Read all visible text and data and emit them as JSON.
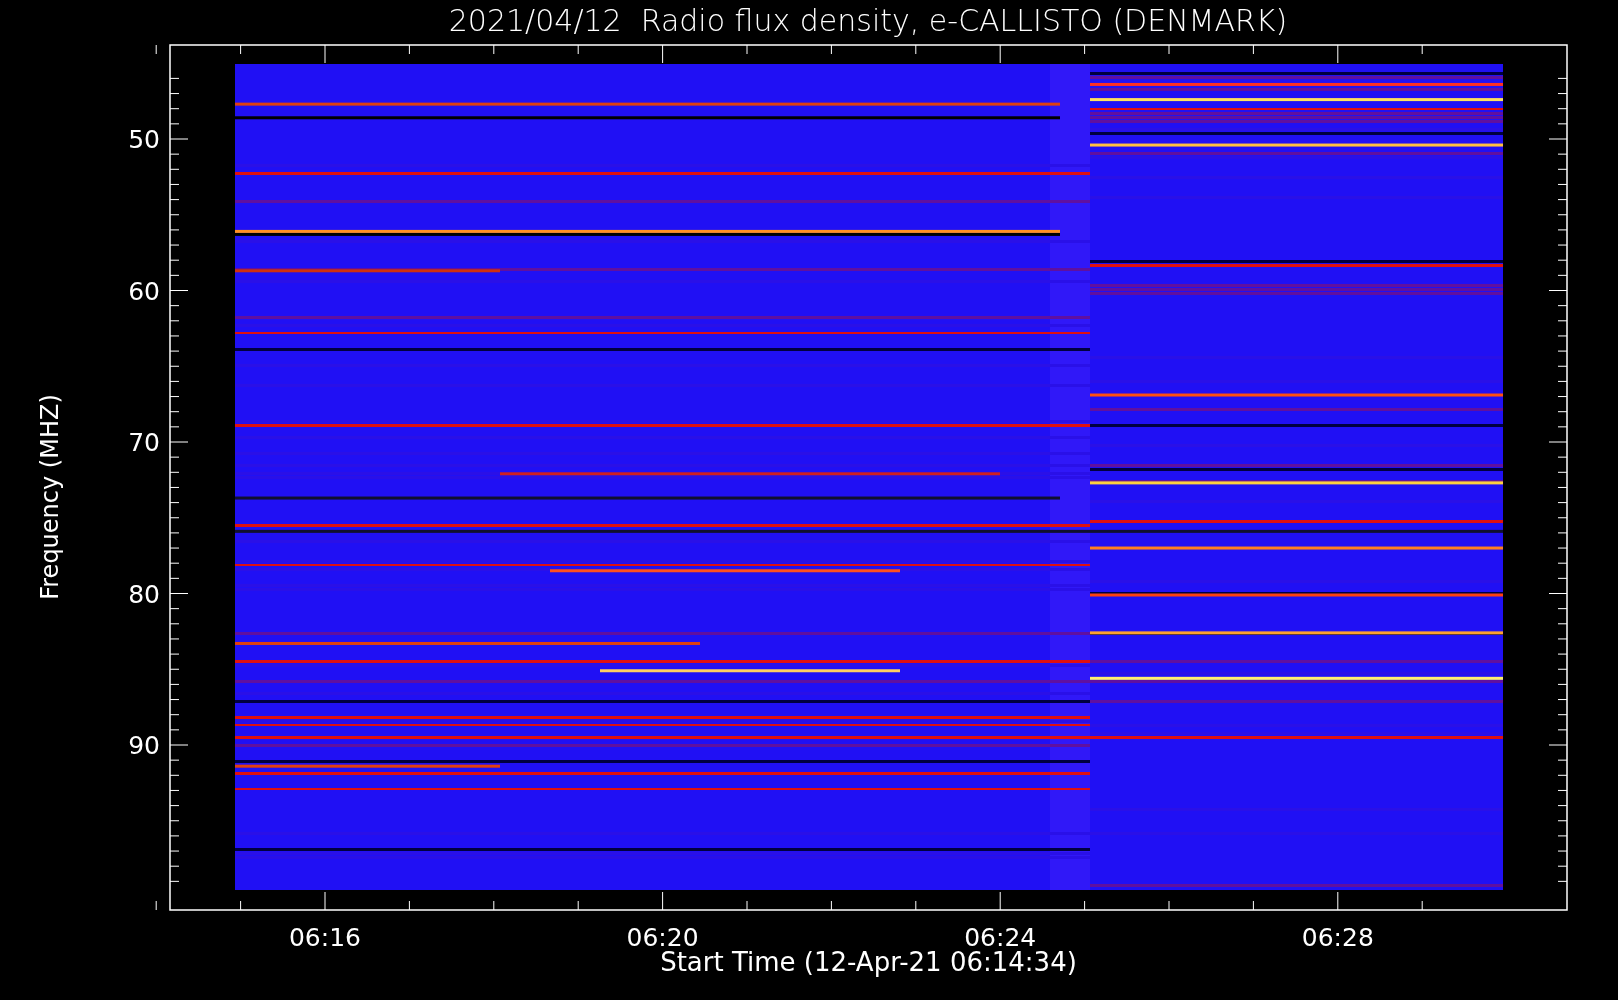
{
  "title": "2021/04/12  Radio flux density, e-CALLISTO (DENMARK)",
  "plot": {
    "y_label": "Frequency (MHZ)",
    "y_ticks": [
      "50",
      "60",
      "70",
      "80",
      "90"
    ],
    "x_ticks": [
      "06:16",
      "06:20",
      "06:24",
      "06:28"
    ],
    "x_label": "Start Time (12-Apr-21 06:14:34)"
  }
}
